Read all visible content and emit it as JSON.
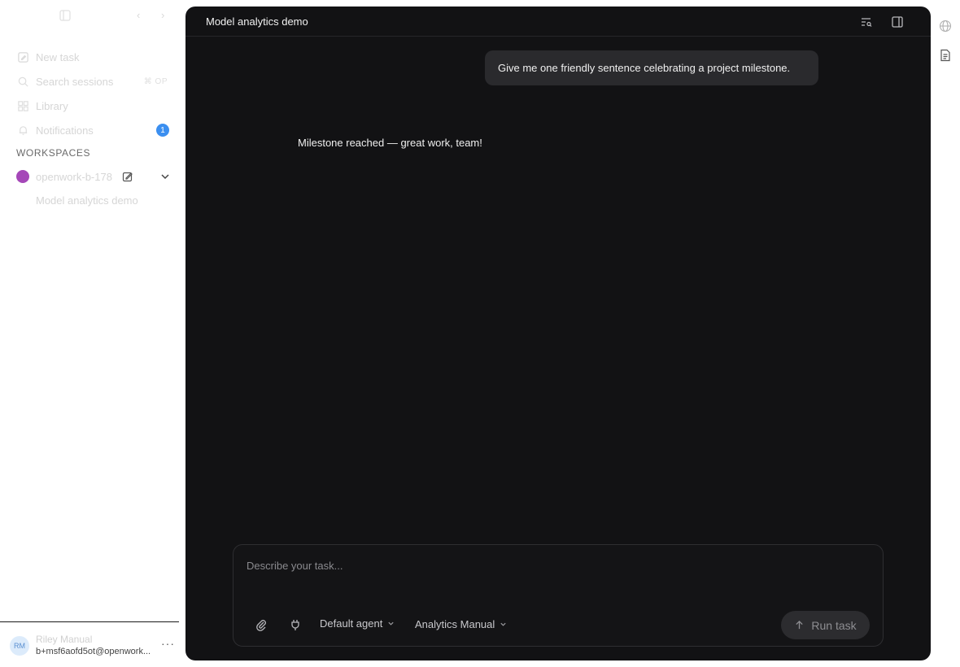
{
  "sidebar": {
    "nav": [
      {
        "label": "New task",
        "icon": "edit-icon"
      },
      {
        "label": "Search sessions",
        "icon": "search-icon",
        "shortcut": "⌘ OP"
      },
      {
        "label": "Library",
        "icon": "grid-icon"
      },
      {
        "label": "Notifications",
        "icon": "bell-icon",
        "badge": "1"
      }
    ],
    "workspaces_heading": "WORKSPACES",
    "workspace": {
      "name": "openwork-b-178",
      "color": "#a547b8"
    },
    "session": "Model analytics demo",
    "user": {
      "initials": "RM",
      "name": "Riley Manual",
      "email": "b+msf6aofd5ot@openwork..."
    },
    "more": "···"
  },
  "main": {
    "title": "Model analytics demo",
    "messages": {
      "user": "Give me one friendly sentence celebrating a project milestone.",
      "assistant": "Milestone reached — great work, team!"
    },
    "composer": {
      "placeholder": "Describe your task...",
      "agent": "Default agent",
      "model": "Analytics Manual",
      "run_label": "Run task"
    }
  },
  "colors": {
    "accent_badge": "#3b8ff0",
    "workspace_dot": "#a547b8",
    "main_bg": "#121214"
  }
}
